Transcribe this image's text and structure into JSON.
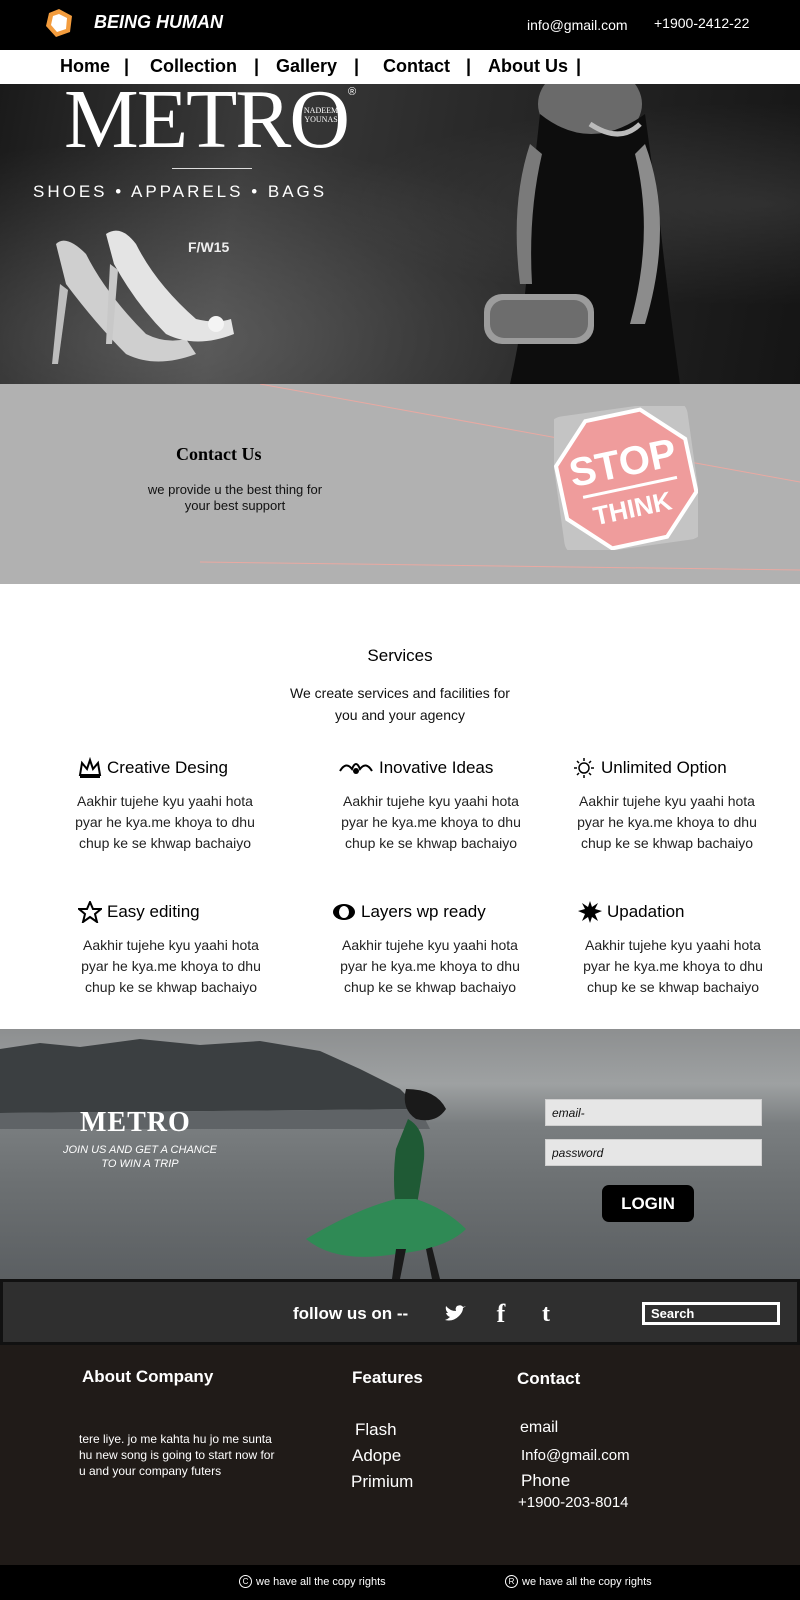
{
  "header": {
    "brand": "BEING HUMAN",
    "email": "info@gmail.com",
    "phone": "+1900-2412-22"
  },
  "nav": {
    "items": [
      "Home",
      "Collection",
      "Gallery",
      "Contact",
      "About Us"
    ],
    "separator": "|"
  },
  "hero": {
    "brand": "METRO",
    "registered": "®",
    "designer": "NADEEM YOUNAS",
    "tagline": "SHOES • APPARELS • BAGS",
    "season": "F/W15"
  },
  "contact": {
    "title": "Contact Us",
    "text": "we provide u the best thing for your best support",
    "sign_top": "STOP",
    "sign_bottom": "THINK"
  },
  "services": {
    "title": "Services",
    "subtitle": "We create services and facilities for you and your agency",
    "items": [
      {
        "title": "Creative Desing",
        "icon": "crown-icon",
        "text": "Aakhir tujehe kyu yaahi hota pyar he kya.me khoya to dhu chup ke se khwap bachaiyo"
      },
      {
        "title": "Inovative Ideas",
        "icon": "ornament-icon",
        "text": "Aakhir tujehe kyu yaahi hota pyar he kya.me khoya to dhu chup ke se khwap bachaiyo"
      },
      {
        "title": "Unlimited Option",
        "icon": "lightbulb-icon",
        "text": "Aakhir tujehe kyu yaahi hota pyar he kya.me khoya to dhu chup ke se khwap bachaiyo"
      },
      {
        "title": "Easy editing",
        "icon": "star-icon",
        "text": "Aakhir tujehe kyu yaahi hota pyar he kya.me khoya to dhu chup ke se khwap bachaiyo"
      },
      {
        "title": "Layers wp ready",
        "icon": "eye-icon",
        "text": "Aakhir tujehe kyu yaahi hota pyar he kya.me khoya to dhu chup ke se khwap bachaiyo"
      },
      {
        "title": "Upadation",
        "icon": "burst-icon",
        "text": "Aakhir tujehe kyu yaahi hota pyar he kya.me khoya to dhu chup ke se khwap bachaiyo"
      }
    ]
  },
  "promo": {
    "brand": "METRO",
    "text": "JOIN US AND GET A CHANCE TO WIN A TRIP"
  },
  "login": {
    "email_placeholder": "email-",
    "password_placeholder": "password",
    "button": "LOGIN"
  },
  "follow": {
    "text": "follow us on --",
    "icons": [
      "twitter-icon",
      "facebook-icon",
      "tumblr-icon"
    ],
    "facebook_glyph": "f",
    "tumblr_glyph": "t",
    "search_placeholder": "Search"
  },
  "footer": {
    "about_title": "About Company",
    "about_text": "tere liye. jo me kahta hu jo me sunta hu new song is going to start now for u and your company futers",
    "features_title": "Features",
    "features": [
      "Flash",
      "Adope",
      "Primium"
    ],
    "contact_title": "Contact",
    "email_label": "email",
    "email_value": "Info@gmail.com",
    "phone_label": "Phone",
    "phone_value": "+1900-203-8014"
  },
  "copyright": {
    "left_symbol": "C",
    "right_symbol": "R",
    "left_text": "we have all the copy rights",
    "right_text": "we have all the copy rights"
  },
  "colors": {
    "topbar": "#000000",
    "contact_band": "#b1b1b1",
    "follow_bar": "#2f2f2f",
    "footer": "#201b18",
    "stop_sign": "#f0a1a1"
  }
}
